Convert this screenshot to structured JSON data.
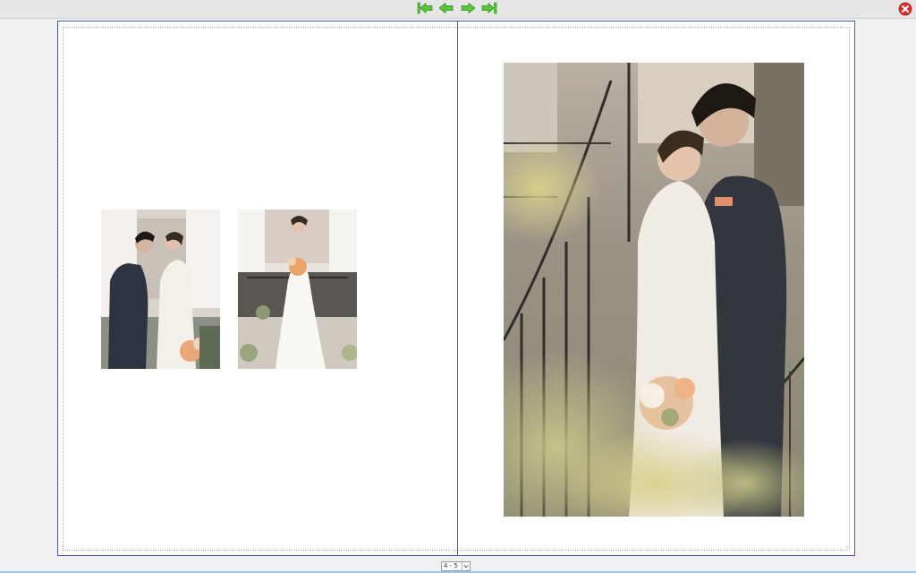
{
  "toolbar": {
    "nav_buttons": [
      {
        "icon": "first-page-icon"
      },
      {
        "icon": "previous-page-icon"
      },
      {
        "icon": "next-page-icon"
      },
      {
        "icon": "last-page-icon"
      }
    ],
    "close_icon": "close-icon",
    "accent_color": "#58c43a",
    "close_color": "#d9302c"
  },
  "spread": {
    "border_color": "#4a5aa8",
    "bleed_color": "#e3a0a0",
    "left_page": {
      "photos": [
        {
          "name": "couple-photo"
        },
        {
          "name": "bride-photo"
        }
      ]
    },
    "right_page": {
      "photos": [
        {
          "name": "couple-staircase-photo"
        }
      ]
    }
  },
  "page_selector": {
    "value": "4 - 5"
  }
}
